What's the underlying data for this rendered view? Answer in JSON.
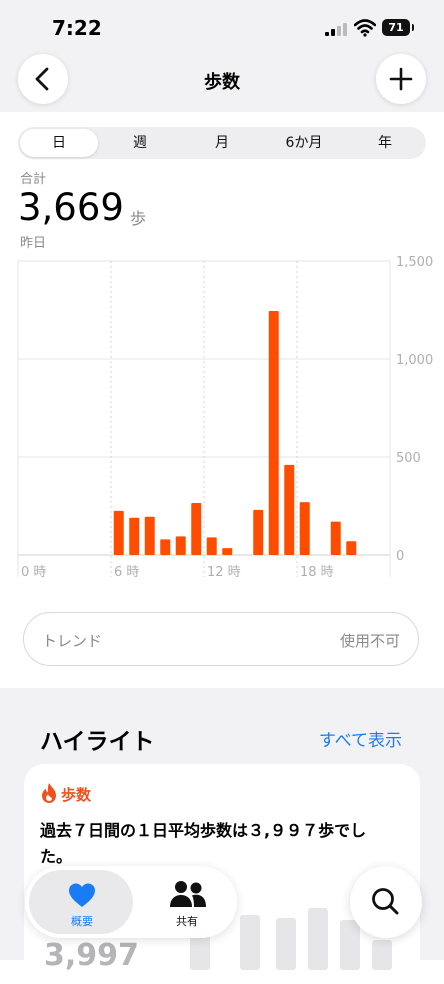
{
  "status": {
    "time": "7:22",
    "battery": "71"
  },
  "nav": {
    "title": "歩数"
  },
  "segments": [
    "日",
    "週",
    "月",
    "6か月",
    "年"
  ],
  "summary": {
    "label": "合計",
    "value": "3,669",
    "unit": "歩",
    "period": "昨日"
  },
  "chart_data": {
    "type": "bar",
    "x": [
      6,
      7,
      8,
      9,
      10,
      11,
      12,
      13,
      15,
      16,
      17,
      18,
      20,
      21
    ],
    "values": [
      225,
      190,
      195,
      80,
      95,
      265,
      90,
      35,
      230,
      1245,
      460,
      270,
      170,
      70
    ],
    "xticks": [
      "0 時",
      "6 時",
      "12 時",
      "18 時"
    ],
    "yticks": [
      "0",
      "500",
      "1,000",
      "1,500"
    ],
    "ylim": [
      0,
      1500
    ],
    "xlim": [
      0,
      24
    ],
    "bar_color": "#ff4d00"
  },
  "trend": {
    "label": "トレンド",
    "status": "使用不可"
  },
  "highlights": {
    "title": "ハイライト",
    "show_all": "すべて表示",
    "card_label": "歩数",
    "card_text": "過去７日間の１日平均歩数は３,９９７歩でした。",
    "card_value": "3,997"
  },
  "tabs": {
    "overview": "概要",
    "sharing": "共有"
  },
  "colors": {
    "accent": "#1a7cf5",
    "orange": "#f0501e"
  }
}
